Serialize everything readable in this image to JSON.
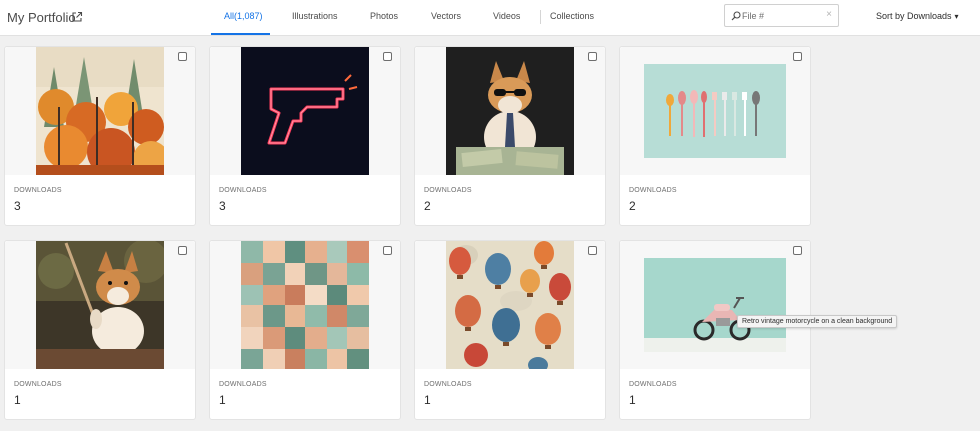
{
  "header": {
    "title": "My Portfolio",
    "tabs": [
      {
        "label": "All(1,087)",
        "active": true
      },
      {
        "label": "Illustrations",
        "active": false
      },
      {
        "label": "Photos",
        "active": false
      },
      {
        "label": "Vectors",
        "active": false
      },
      {
        "label": "Videos",
        "active": false
      },
      {
        "label": "Collections",
        "active": false
      }
    ],
    "search": {
      "placeholder": "File #",
      "value": ""
    },
    "sort_label": "Sort by Downloads"
  },
  "grid": {
    "items": [
      {
        "subject": "watercolor autumn forest",
        "downloads_label": "DOWNLOADS",
        "downloads": "3"
      },
      {
        "subject": "neon pistol",
        "downloads_label": "DOWNLOADS",
        "downloads": "3"
      },
      {
        "subject": "corgi with sunglasses and money",
        "downloads_label": "DOWNLOADS",
        "downloads": "2"
      },
      {
        "subject": "pastel spoons and forks",
        "downloads_label": "DOWNLOADS",
        "downloads": "2"
      },
      {
        "subject": "corgi holding a stick",
        "downloads_label": "DOWNLOADS",
        "downloads": "1"
      },
      {
        "subject": "abstract teal and peach collage",
        "downloads_label": "DOWNLOADS",
        "downloads": "1"
      },
      {
        "subject": "hot air balloons pattern",
        "downloads_label": "DOWNLOADS",
        "downloads": "1"
      },
      {
        "subject": "retro vintage motorcycle",
        "downloads_label": "DOWNLOADS",
        "downloads": "1"
      }
    ]
  },
  "tooltip": "Retro vintage motorcycle on a clean background",
  "colors": {
    "accent": "#1473e6",
    "background": "#f0f0f0",
    "card": "#ffffff"
  }
}
